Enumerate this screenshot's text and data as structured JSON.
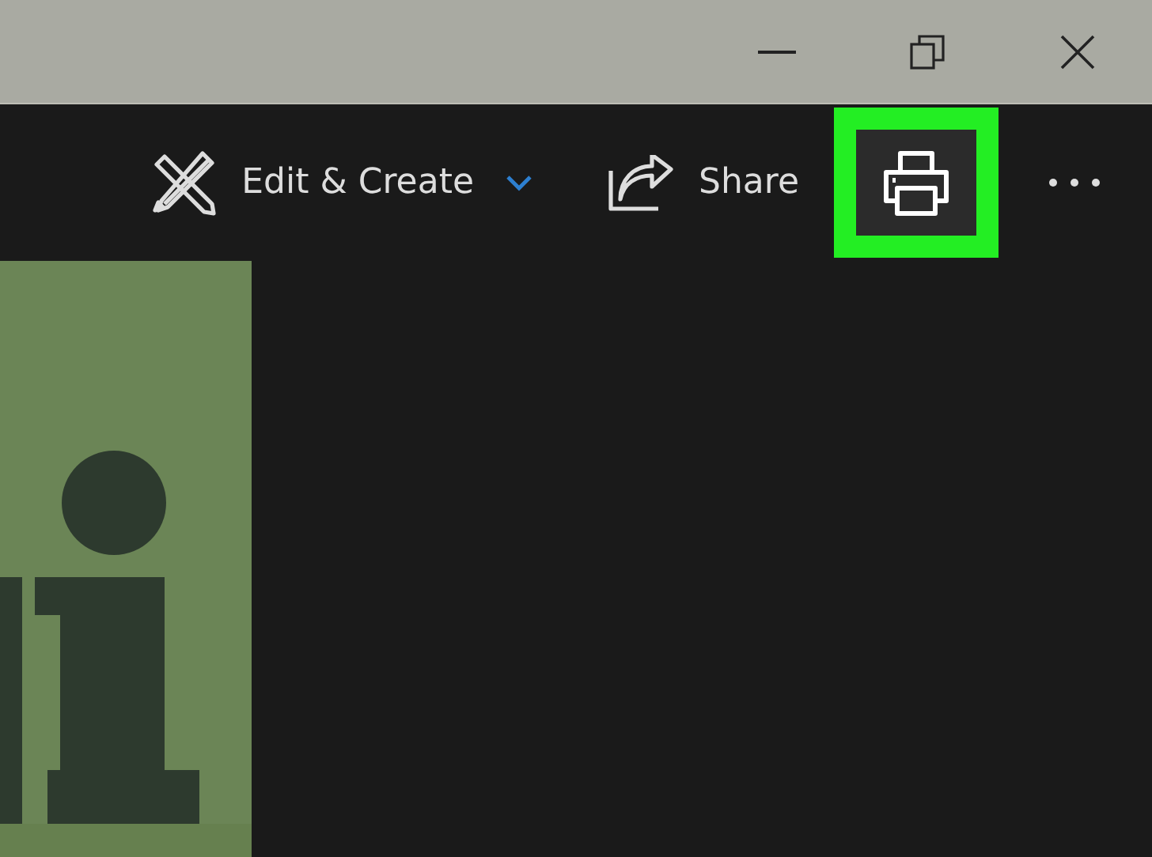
{
  "window_controls": [
    {
      "kind": "minimize"
    },
    {
      "kind": "restore"
    },
    {
      "kind": "close"
    }
  ],
  "toolbar": [
    {
      "kind": "edit",
      "label": "Edit & Create",
      "dropdown": true
    },
    {
      "kind": "share",
      "label": "Share"
    },
    {
      "kind": "print",
      "highlighted": true
    },
    {
      "kind": "more"
    }
  ]
}
